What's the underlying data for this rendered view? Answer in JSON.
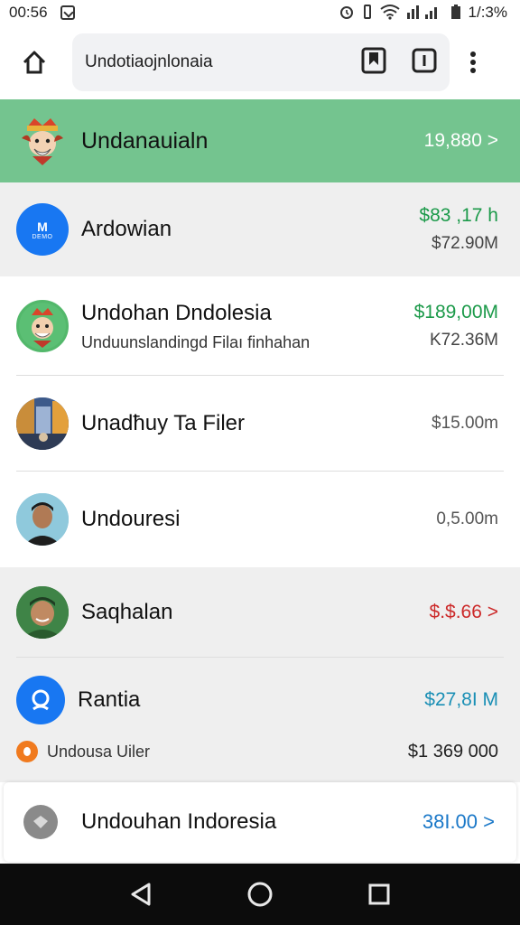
{
  "status_bar": {
    "time": "00:56",
    "battery": "1/:3%"
  },
  "toolbar": {
    "url": "Undotiaojnlonaia"
  },
  "header_row": {
    "name": "Undanauialn",
    "value": "19,880 >"
  },
  "rows": [
    {
      "name": "Ardowian",
      "sub": "",
      "value1": "$83 ,17 h",
      "value2": "$72.90M",
      "value1_color": "#1c9a4a",
      "avatar_text": "M",
      "avatar_subtext": "DEMO"
    },
    {
      "name": "Undohan Dndolesia",
      "sub": "Unduunslandingd Filaı finhahan",
      "value1": "$189,00M",
      "value2": "K72.36M",
      "value1_color": "#1c9a4a"
    },
    {
      "name": "Unadħuy Ta Filer",
      "sub": "",
      "value1": "$15.00m",
      "value2": "",
      "value1_color": "#555555"
    },
    {
      "name": "Undouresi",
      "sub": "",
      "value1": "0,5.00m",
      "value2": "",
      "value1_color": "#555555"
    },
    {
      "name": "Saqhalan",
      "sub": "",
      "value1": "$.$.66 >",
      "value2": "",
      "value1_color": "#cc2a2a"
    },
    {
      "name": "Rantia",
      "sub": "Undousa Uiler",
      "value1": "$27,8I M",
      "value2": "$1 369 000",
      "value1_color": "#1a8fb5"
    }
  ],
  "bottom_card": {
    "name": "Undouhan Indoresia",
    "value": "38I.00 >",
    "value_color": "#1a78c8"
  },
  "icons": {
    "home": "home-icon",
    "bookmark": "bookmark-icon",
    "tabs": "tabs-icon",
    "menu": "more-vert-icon",
    "back": "back-icon",
    "home_nav": "home-circle-icon",
    "recents": "recents-icon"
  },
  "colors": {
    "header_green": "#74c48f",
    "nav_bar": "#0c0c0c",
    "avatar_blue": "#1877f2"
  }
}
